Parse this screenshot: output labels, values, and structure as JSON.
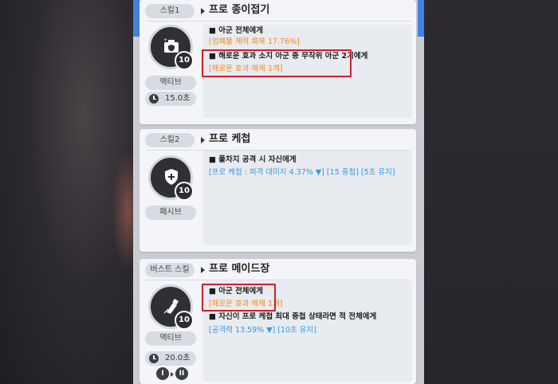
{
  "skills": [
    {
      "tag": "스킬1",
      "name": "프로 종이접기",
      "level": "10",
      "type": "액티브",
      "cooldown": "15.0초",
      "lines": [
        {
          "text": "■ 아군 전체에게",
          "style": "head"
        },
        {
          "text": "[엄폐물 체력 회복 17.76%]",
          "style": "orange"
        },
        {
          "text": "■ 해로운 효과 소지 아군 중 무작위 아군 2기에게",
          "style": "head"
        },
        {
          "text": "[해로운 효과 해제 1개]",
          "style": "orange"
        }
      ]
    },
    {
      "tag": "스킬2",
      "name": "프로 케첩",
      "level": "10",
      "type": "패시브",
      "lines": [
        {
          "text": "■ 풀차지 공격 시 자신에게",
          "style": "head"
        },
        {
          "text": "[프로 케첩 : 피격 대미지 4.37% ▼] [15 중첩] [5초 유지]",
          "style": "blue"
        }
      ]
    },
    {
      "tag": "버스트 스킬",
      "name": "프로 메이드장",
      "level": "10",
      "type": "액티브",
      "cooldown": "20.0초",
      "burst_from": "I",
      "burst_to": "II",
      "lines": [
        {
          "text": "■ 아군 전체에게",
          "style": "head"
        },
        {
          "text": "[해로운 효과 해제 1개]",
          "style": "orange"
        },
        {
          "text": "■ 자신이 프로 케첩 최대 중첩 상태라면 적 전체에게",
          "style": "head"
        },
        {
          "text": "[공격력 13.59% ▼] [10초 유지]",
          "style": "blue"
        }
      ]
    }
  ],
  "icons": [
    "photo-shield-icon",
    "shield-icon",
    "glue-tube-icon",
    "clock-icon"
  ],
  "colors": {
    "orange": "#f08a1d",
    "blue": "#2d9be3",
    "highlight": "#d21e2c",
    "accent": "#3f82e0"
  }
}
